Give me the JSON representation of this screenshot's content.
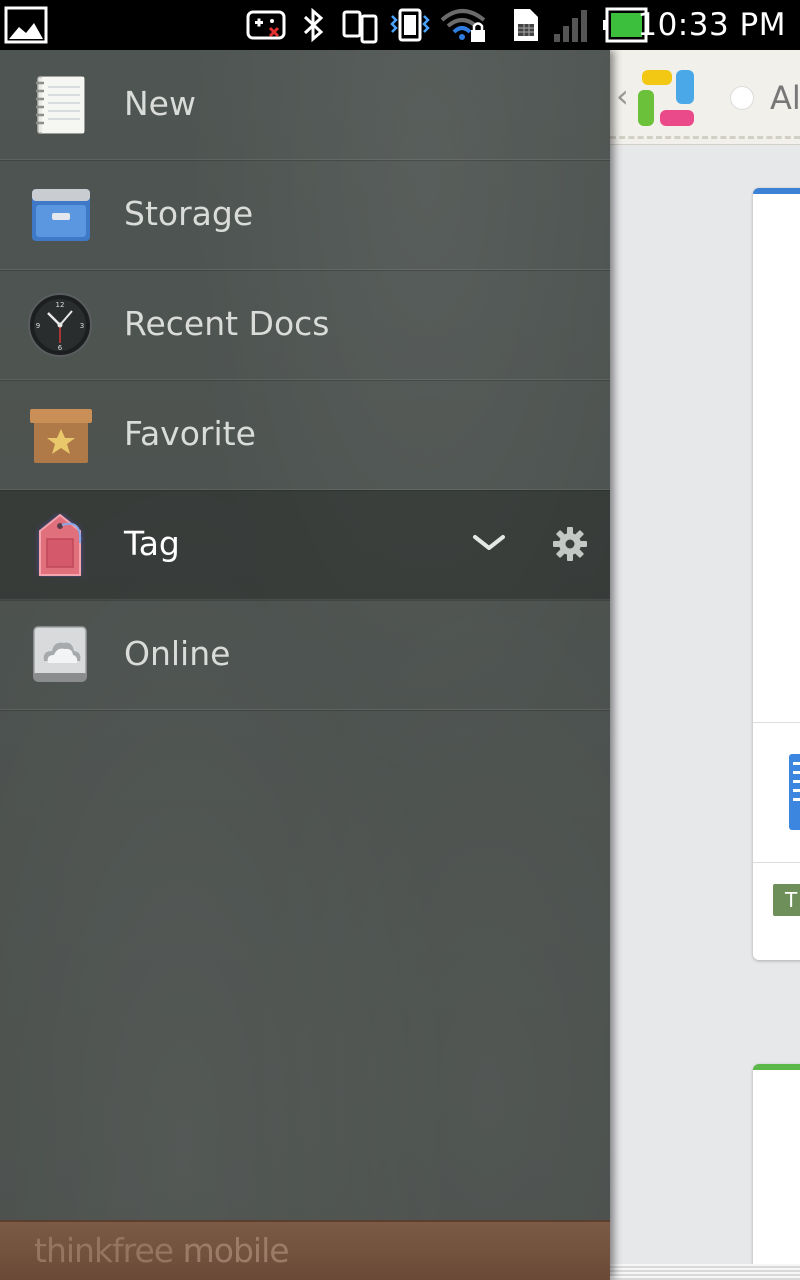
{
  "status_bar": {
    "time": "10:33 PM",
    "icons": [
      "gallery-notification-icon",
      "gamepad-disabled-icon",
      "bluetooth-icon",
      "screen-mirror-icon",
      "vibrate-icon",
      "wifi-locked-icon",
      "sim-card-icon",
      "signal-icon",
      "battery-icon"
    ]
  },
  "drawer": {
    "items": [
      {
        "label": "New",
        "icon": "notebook-icon"
      },
      {
        "label": "Storage",
        "icon": "file-cabinet-icon"
      },
      {
        "label": "Recent Docs",
        "icon": "clock-icon"
      },
      {
        "label": "Favorite",
        "icon": "star-box-icon"
      },
      {
        "label": "Tag",
        "icon": "tag-icon",
        "selected": true
      },
      {
        "label": "Online",
        "icon": "cloud-drive-icon"
      }
    ],
    "footer": {
      "brand_part1": "thinkfree",
      "brand_part2": " mobile"
    }
  },
  "content": {
    "filter_label": "Al",
    "tag_chip": "T"
  },
  "colors": {
    "drawer_bg": "#4d5350",
    "footer_bg": "#735140",
    "card1_accent": "#3b82d6",
    "card2_accent": "#5db84a",
    "tag_chip": "#6e8f5a"
  }
}
